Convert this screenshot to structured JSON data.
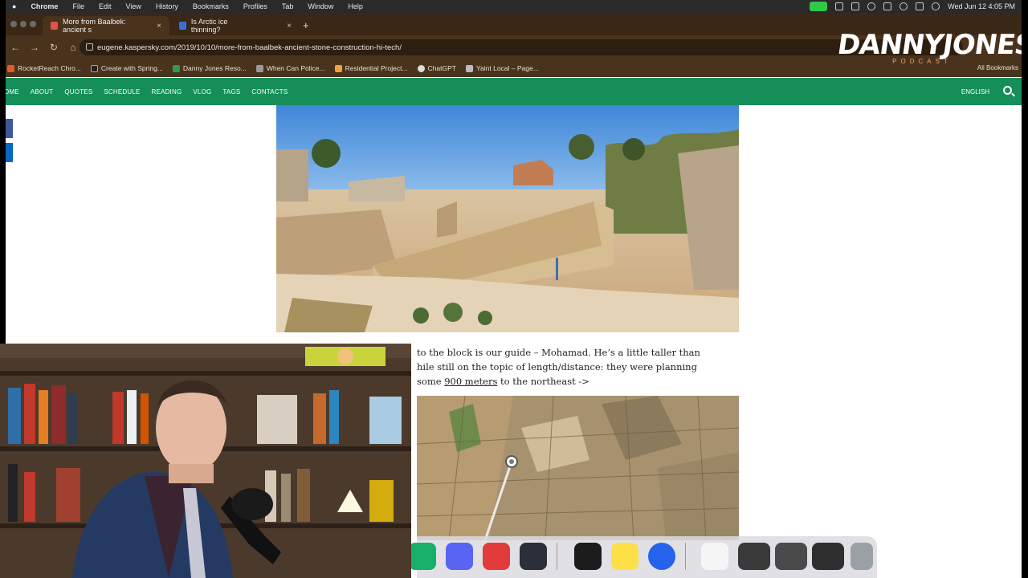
{
  "menubar": {
    "apple": "",
    "app": "Chrome",
    "menus": [
      "File",
      "Edit",
      "View",
      "History",
      "Bookmarks",
      "Profiles",
      "Tab",
      "Window",
      "Help"
    ],
    "datetime": "Wed Jun 12  4:05 PM"
  },
  "tabs": [
    {
      "title": "More from Baalbek: ancient s",
      "active": true,
      "favicon_color": "#e0534a"
    },
    {
      "title": "Is Arctic ice thinning?",
      "active": false,
      "favicon_color": "#3b6fd6"
    }
  ],
  "newtab_label": "+",
  "address": {
    "url": "eugene.kaspersky.com/2019/10/10/more-from-baalbek-ancient-stone-construction-hi-tech/"
  },
  "nav_icons": {
    "back": "←",
    "forward": "→",
    "reload": "↻",
    "home": "⌂"
  },
  "bookmarks": [
    {
      "label": "RocketReach Chro...",
      "color": "#e85a2c"
    },
    {
      "label": "Create with Spring...",
      "color": "#222"
    },
    {
      "label": "Danny Jones Reso...",
      "color": "#2e9a4a"
    },
    {
      "label": "When Can Police...",
      "color": "#999"
    },
    {
      "label": "Residential Project...",
      "color": "#f2a23a"
    },
    {
      "label": "ChatGPT",
      "color": "#ddd"
    },
    {
      "label": "Yaint Local – Page...",
      "color": "#bbb"
    }
  ],
  "all_bookmarks": "All Bookmarks",
  "logo": {
    "title": "DANNYJONES",
    "subtitle": "PODCAST"
  },
  "site_nav": {
    "items": [
      "HOME",
      "ABOUT",
      "QUOTES",
      "SCHEDULE",
      "READING",
      "VLOG",
      "TAGS",
      "CONTACTS"
    ],
    "language": "ENGLISH"
  },
  "article": {
    "line1": "to the block is our guide – Mohamad. He’s a little taller than",
    "line2": "hile still on the topic of length/distance: they were planning",
    "line3_prefix": " some ",
    "line3_link": "900 meters",
    "line3_suffix": " to the northeast ->"
  },
  "colors": {
    "menubar": "#2a2a2a",
    "chrome_frame": "#4a331d",
    "site_nav": "#168e5a",
    "logo_accent": "#e7a76a"
  },
  "dock_icons": [
    "app-icon",
    "discord-icon",
    "podcast-icon",
    "davinci-resolve-icon",
    "piano-icon",
    "notes-icon",
    "quicktime-icon",
    "shopify-window-thumbnail",
    "window-thumbnail",
    "window-thumbnail",
    "window-thumbnail",
    "trash-icon"
  ]
}
